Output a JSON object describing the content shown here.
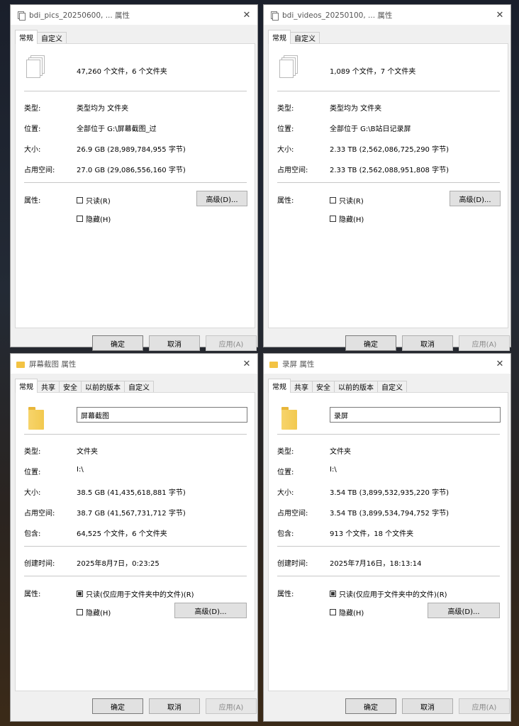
{
  "windows": [
    {
      "title": "bdi_pics_20250600, ... 属性",
      "tabs": [
        "常规",
        "自定义"
      ],
      "summary": "47,260 个文件，6 个文件夹",
      "rows": [
        {
          "label": "类型:",
          "value": "类型均为 文件夹"
        },
        {
          "label": "位置:",
          "value": "全部位于 G:\\屏幕截图_过"
        },
        {
          "label": "大小:",
          "value": "26.9 GB (28,989,784,955 字节)"
        },
        {
          "label": "占用空间:",
          "value": "27.0 GB (29,086,556,160 字节)"
        }
      ],
      "attr_label": "属性:",
      "readonly": "只读(R)",
      "hidden": "隐藏(H)",
      "advanced": "高级(D)...",
      "ok": "确定",
      "cancel": "取消",
      "apply": "应用(A)"
    },
    {
      "title": "bdi_videos_20250100, ... 属性",
      "tabs": [
        "常规",
        "自定义"
      ],
      "summary": "1,089 个文件，7 个文件夹",
      "rows": [
        {
          "label": "类型:",
          "value": "类型均为 文件夹"
        },
        {
          "label": "位置:",
          "value": "全部位于 G:\\B站日记录屏"
        },
        {
          "label": "大小:",
          "value": "2.33 TB (2,562,086,725,290 字节)"
        },
        {
          "label": "占用空间:",
          "value": "2.33 TB (2,562,088,951,808 字节)"
        }
      ],
      "attr_label": "属性:",
      "readonly": "只读(R)",
      "hidden": "隐藏(H)",
      "advanced": "高级(D)...",
      "ok": "确定",
      "cancel": "取消",
      "apply": "应用(A)"
    },
    {
      "title": "屏幕截图 属性",
      "tabs": [
        "常规",
        "共享",
        "安全",
        "以前的版本",
        "自定义"
      ],
      "name": "屏幕截图",
      "rows": [
        {
          "label": "类型:",
          "value": "文件夹"
        },
        {
          "label": "位置:",
          "value": "I:\\"
        },
        {
          "label": "大小:",
          "value": "38.5 GB (41,435,618,881 字节)"
        },
        {
          "label": "占用空间:",
          "value": "38.7 GB (41,567,731,712 字节)"
        },
        {
          "label": "包含:",
          "value": "64,525 个文件，6 个文件夹"
        }
      ],
      "created_label": "创建时间:",
      "created": "2025年8月7日，0:23:25",
      "attr_label": "属性:",
      "readonly": "只读(仅应用于文件夹中的文件)(R)",
      "hidden": "隐藏(H)",
      "advanced": "高级(D)...",
      "ok": "确定",
      "cancel": "取消",
      "apply": "应用(A)"
    },
    {
      "title": "录屏 属性",
      "tabs": [
        "常规",
        "共享",
        "安全",
        "以前的版本",
        "自定义"
      ],
      "name": "录屏",
      "rows": [
        {
          "label": "类型:",
          "value": "文件夹"
        },
        {
          "label": "位置:",
          "value": "I:\\"
        },
        {
          "label": "大小:",
          "value": "3.54 TB (3,899,532,935,220 字节)"
        },
        {
          "label": "占用空间:",
          "value": "3.54 TB (3,899,534,794,752 字节)"
        },
        {
          "label": "包含:",
          "value": "913 个文件，18 个文件夹"
        }
      ],
      "created_label": "创建时间:",
      "created": "2025年7月16日，18:13:14",
      "attr_label": "属性:",
      "readonly": "只读(仅应用于文件夹中的文件)(R)",
      "hidden": "隐藏(H)",
      "advanced": "高级(D)...",
      "ok": "确定",
      "cancel": "取消",
      "apply": "应用(A)"
    }
  ]
}
